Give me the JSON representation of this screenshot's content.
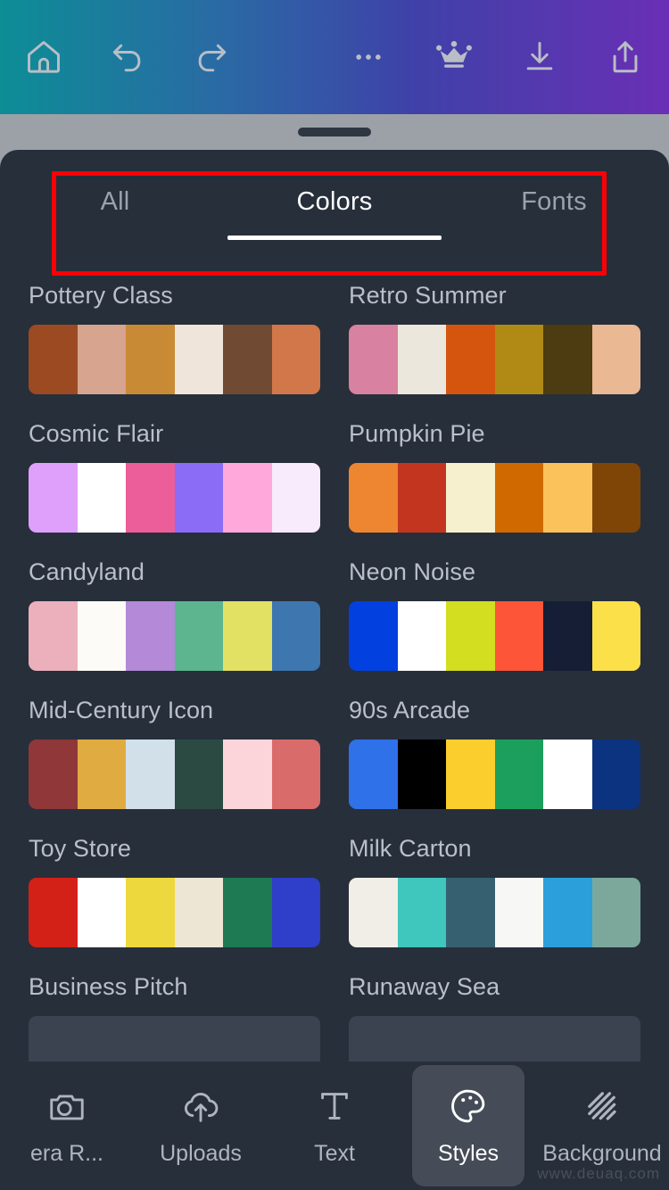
{
  "topbar": {
    "gradient_start": "#0d8d96",
    "gradient_end": "#6a2fb5",
    "left_icons": [
      {
        "name": "home-icon",
        "label": "Home"
      },
      {
        "name": "undo-icon",
        "label": "Undo"
      },
      {
        "name": "redo-icon",
        "label": "Redo"
      }
    ],
    "right_icons": [
      {
        "name": "more-icon",
        "label": "More"
      },
      {
        "name": "crown-icon",
        "label": "Pro"
      },
      {
        "name": "download-icon",
        "label": "Download"
      },
      {
        "name": "share-icon",
        "label": "Share"
      }
    ]
  },
  "sheet": {
    "background": "#272f3b",
    "highlight_color": "#fb0007"
  },
  "tabs": [
    {
      "label": "All",
      "active": false
    },
    {
      "label": "Colors",
      "active": true
    },
    {
      "label": "Fonts",
      "active": false
    }
  ],
  "palettes": [
    {
      "name": "Pottery Class",
      "colors": [
        "#9c4a22",
        "#d6a48f",
        "#c98a35",
        "#efe5da",
        "#714a33",
        "#d1774a"
      ]
    },
    {
      "name": "Retro Summer",
      "colors": [
        "#d981a0",
        "#ece7dc",
        "#d5550e",
        "#b08a15",
        "#4d3c11",
        "#ebb894"
      ]
    },
    {
      "name": "Cosmic Flair",
      "colors": [
        "#dfa0fb",
        "#ffffff",
        "#ec5e99",
        "#8a6cf6",
        "#ffa8dc",
        "#f8ebfc"
      ]
    },
    {
      "name": "Pumpkin Pie",
      "colors": [
        "#ee8531",
        "#c43520",
        "#f6f0ce",
        "#d06a00",
        "#fbc25c",
        "#7e4506"
      ]
    },
    {
      "name": "Candyland",
      "colors": [
        "#ebb0bc",
        "#fdfbf7",
        "#b389d8",
        "#5cb58f",
        "#e3e163",
        "#3e76b0"
      ]
    },
    {
      "name": "Neon Noise",
      "colors": [
        "#0240e0",
        "#ffffff",
        "#d2de1f",
        "#fc5537",
        "#151e35",
        "#fce04a"
      ]
    },
    {
      "name": "Mid-Century Icon",
      "colors": [
        "#8f3739",
        "#e0ac42",
        "#d2e0ea",
        "#2a4a42",
        "#fcd5db",
        "#d96b6b"
      ]
    },
    {
      "name": "90s Arcade",
      "colors": [
        "#2f71e8",
        "#000000",
        "#fcce2d",
        "#1c9e5c",
        "#ffffff",
        "#0c3380"
      ]
    },
    {
      "name": "Toy Store",
      "colors": [
        "#d32118",
        "#ffffff",
        "#edd83d",
        "#ede6d5",
        "#1d7a52",
        "#2f3fc9"
      ]
    },
    {
      "name": "Milk Carton",
      "colors": [
        "#f0eee6",
        "#3fc6bd",
        "#36606f",
        "#f7f7f5",
        "#2b9fd9",
        "#7ca89c"
      ]
    },
    {
      "name": "Business Pitch",
      "colors": [
        "#3b4350",
        "#3b4350",
        "#3b4350",
        "#3b4350",
        "#3b4350",
        "#3b4350"
      ]
    },
    {
      "name": "Runaway Sea",
      "colors": [
        "#3b4350",
        "#3b4350",
        "#3b4350",
        "#3b4350",
        "#3b4350",
        "#3b4350"
      ]
    }
  ],
  "bottom_nav": [
    {
      "label": "era R...",
      "icon": "camera-icon",
      "active": false
    },
    {
      "label": "Uploads",
      "icon": "upload-cloud-icon",
      "active": false
    },
    {
      "label": "Text",
      "icon": "text-icon",
      "active": false
    },
    {
      "label": "Styles",
      "icon": "palette-icon",
      "active": true
    },
    {
      "label": "Background",
      "icon": "hatch-icon",
      "active": false
    }
  ],
  "watermark": "www.deuaq.com"
}
